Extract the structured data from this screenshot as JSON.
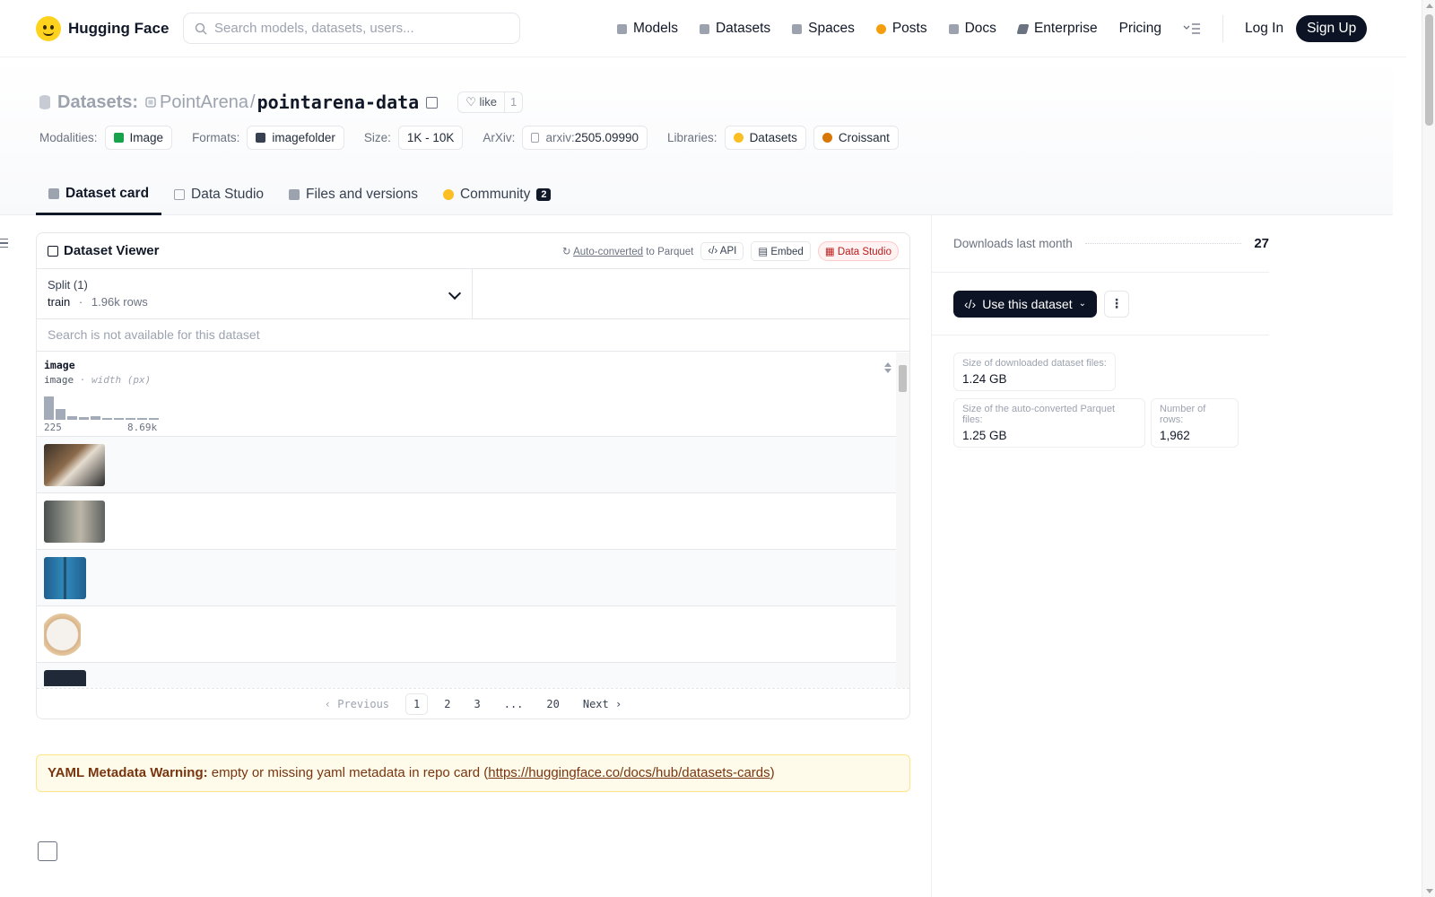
{
  "header": {
    "brand": "Hugging Face",
    "search_placeholder": "Search models, datasets, users...",
    "nav": [
      "Models",
      "Datasets",
      "Spaces",
      "Posts",
      "Docs",
      "Enterprise",
      "Pricing"
    ],
    "login": "Log In",
    "signup": "Sign Up"
  },
  "repo": {
    "kind": "Datasets:",
    "owner": "PointArena",
    "sep": "/",
    "name": "pointarena-data",
    "like_label": "like",
    "like_count": "1",
    "meta": {
      "modalities_label": "Modalities:",
      "modalities": "Image",
      "formats_label": "Formats:",
      "formats": "imagefolder",
      "size_label": "Size:",
      "size": "1K - 10K",
      "arxiv_label": "ArXiv:",
      "arxiv_prefix": "arxiv:",
      "arxiv_id": "2505.09990",
      "libraries_label": "Libraries:",
      "libraries": [
        "Datasets",
        "Croissant"
      ]
    },
    "tabs": [
      "Dataset card",
      "Data Studio",
      "Files and versions",
      "Community"
    ],
    "community_count": "2"
  },
  "viewer": {
    "title": "Dataset Viewer",
    "auto_converted": "Auto-converted",
    "to_parquet": "to Parquet",
    "api": "API",
    "embed": "Embed",
    "data_studio": "Data Studio",
    "split_label": "Split (1)",
    "split_name": "train",
    "split_dot": "·",
    "split_rows": "1.96k rows",
    "search_na": "Search is not available for this dataset",
    "column": {
      "name": "image",
      "type": "image",
      "type_sep": "·",
      "type_detail": "width (px)",
      "hist_min": "225",
      "hist_max": "8.69k",
      "hist_values": [
        1.0,
        0.45,
        0.15,
        0.1,
        0.15,
        0.06,
        0.05,
        0.05,
        0.04,
        0.04
      ]
    },
    "pager": {
      "prev": "Previous",
      "pages": [
        "1",
        "2",
        "3",
        "...",
        "20"
      ],
      "current": "1",
      "next": "Next"
    }
  },
  "warning": {
    "title": "YAML Metadata Warning:",
    "text": " empty or missing yaml metadata in repo card (",
    "link": "https://huggingface.co/docs/hub/datasets-cards",
    "close": ")"
  },
  "sidebar": {
    "downloads_label": "Downloads last month",
    "downloads": "27",
    "use_button": "Use this dataset",
    "more": "⋮",
    "stats": {
      "download_size_label": "Size of downloaded dataset files:",
      "download_size": "1.24 GB",
      "parquet_size_label": "Size of the auto-converted Parquet files:",
      "parquet_size": "1.25 GB",
      "rows_label": "Number of rows:",
      "rows": "1,962"
    }
  }
}
